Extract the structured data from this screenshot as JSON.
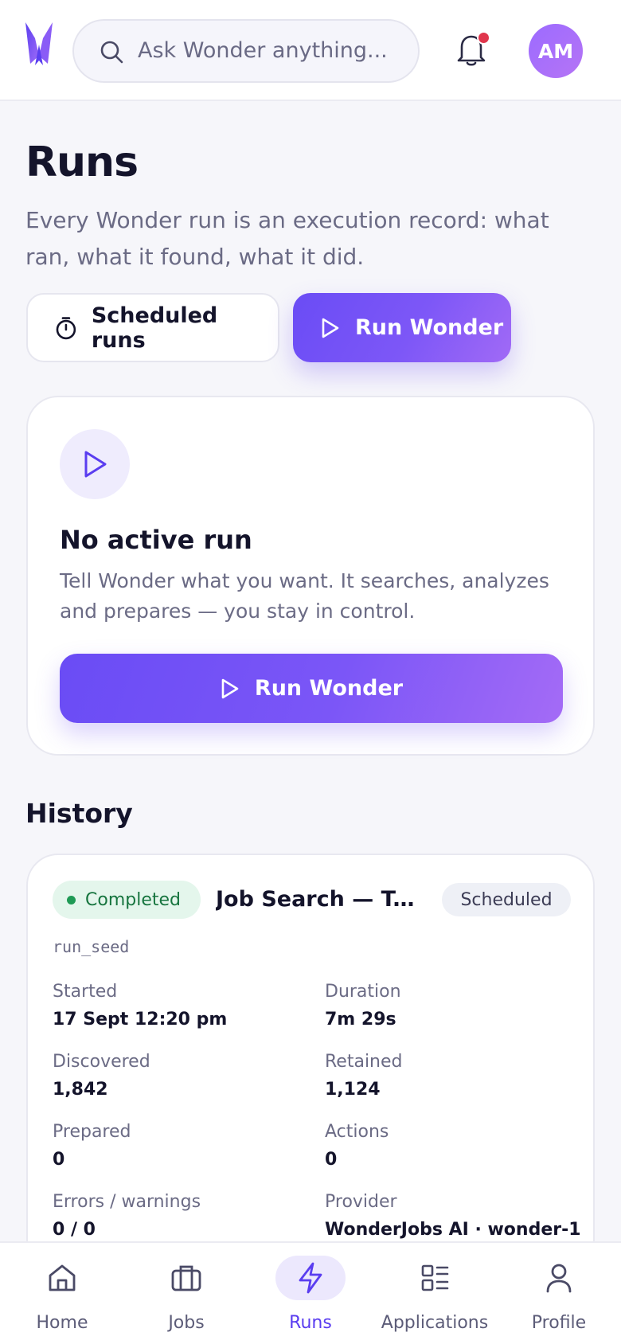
{
  "header": {
    "search": {
      "placeholder": "Ask Wonder anything..."
    },
    "avatar_initials": "AM",
    "notification_dot": true,
    "brand_color": "#6a4cf5"
  },
  "page": {
    "title": "Runs",
    "description": "Every Wonder run is an execution record: what ran, what it found, what it did.",
    "scheduled_runs_label": "Scheduled runs",
    "run_wonder_label": "Run Wonder"
  },
  "active_run": {
    "title": "No active run",
    "description": "Tell Wonder what you want. It searches, analyzes and prepares — you stay in control.",
    "button_label": "Run Wonder"
  },
  "history": {
    "title": "History",
    "runs": [
      {
        "status": "Completed",
        "name": "Job Search — Tec...",
        "schedule_badge": "Scheduled",
        "run_id": "run_seed",
        "fields": [
          {
            "label": "Started",
            "value": "17 Sept 12:20 pm"
          },
          {
            "label": "Duration",
            "value": "7m 29s"
          },
          {
            "label": "Discovered",
            "value": "1,842"
          },
          {
            "label": "Retained",
            "value": "1,124"
          },
          {
            "label": "Prepared",
            "value": "0"
          },
          {
            "label": "Actions",
            "value": "0"
          },
          {
            "label": "Errors / warnings",
            "value": "0 / 0"
          },
          {
            "label": "Provider",
            "value": "WonderJobs AI · wonder-1"
          }
        ]
      }
    ]
  },
  "bottom_nav": {
    "items": [
      {
        "label": "Home",
        "icon": "home-icon"
      },
      {
        "label": "Jobs",
        "icon": "briefcase-icon"
      },
      {
        "label": "Runs",
        "icon": "lightning-icon",
        "active": true
      },
      {
        "label": "Applications",
        "icon": "grid-list-icon"
      },
      {
        "label": "Profile",
        "icon": "user-icon"
      }
    ]
  }
}
